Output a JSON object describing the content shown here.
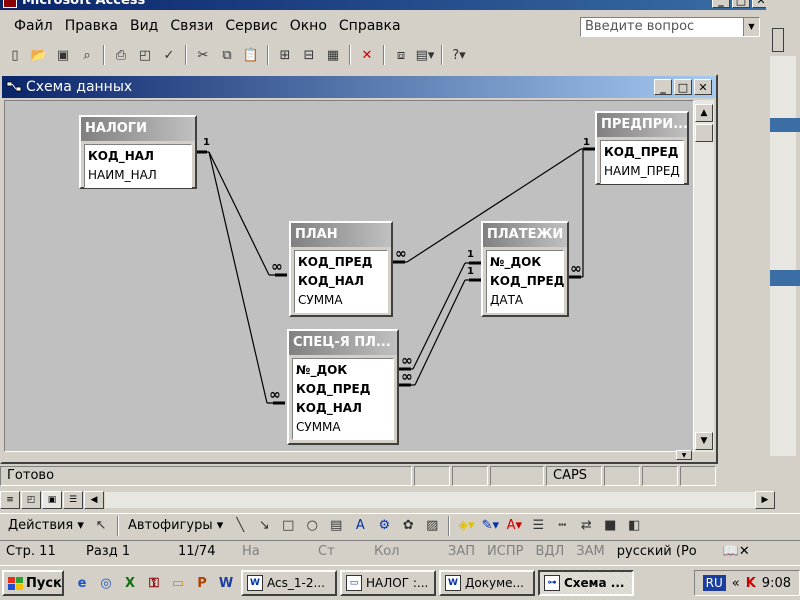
{
  "app": {
    "title": "Microsoft Access"
  },
  "menu": {
    "items": [
      "Файл",
      "Правка",
      "Вид",
      "Связи",
      "Сервис",
      "Окно",
      "Справка"
    ],
    "help_placeholder": "Введите вопрос"
  },
  "schema_window": {
    "title": "Схема данных",
    "tables": [
      {
        "name": "НАЛОГИ",
        "fields": [
          {
            "name": "КОД_НАЛ",
            "key": true
          },
          {
            "name": "НАИМ_НАЛ",
            "key": false
          }
        ]
      },
      {
        "name": "ПРЕДПРИ...",
        "fields": [
          {
            "name": "КОД_ПРЕД",
            "key": true
          },
          {
            "name": "НАИМ_ПРЕД",
            "key": false
          }
        ]
      },
      {
        "name": "ПЛАН",
        "fields": [
          {
            "name": "КОД_ПРЕД",
            "key": true
          },
          {
            "name": "КОД_НАЛ",
            "key": true
          },
          {
            "name": "СУММА",
            "key": false
          }
        ]
      },
      {
        "name": "ПЛАТЕЖИ",
        "fields": [
          {
            "name": "№_ДОК",
            "key": true
          },
          {
            "name": "КОД_ПРЕД",
            "key": true
          },
          {
            "name": "ДАТА",
            "key": false
          }
        ]
      },
      {
        "name": "СПЕЦ-Я ПЛ...",
        "fields": [
          {
            "name": "№_ДОК",
            "key": true
          },
          {
            "name": "КОД_ПРЕД",
            "key": true
          },
          {
            "name": "КОД_НАЛ",
            "key": true
          },
          {
            "name": "СУММА",
            "key": false
          }
        ]
      }
    ],
    "rel_one": "1",
    "rel_many": "∞"
  },
  "status": {
    "ready": "Готово",
    "caps": "CAPS"
  },
  "drawing_toolbar": {
    "actions": "Действия",
    "autoshapes": "Автофигуры"
  },
  "word_status": {
    "page": "Стр. 11",
    "section": "Разд 1",
    "pages": "11/74",
    "at": "На",
    "line": "Ст",
    "col": "Кол",
    "rec": "ЗАП",
    "trk": "ИСПР",
    "ext": "ВДЛ",
    "ovr": "ЗАМ",
    "lang": "русский (Ро"
  },
  "taskbar": {
    "start": "Пуск",
    "tasks": [
      "Acs_1-2...",
      "НАЛОГ :...",
      "Докуме...",
      "Схема ..."
    ],
    "lang": "RU",
    "clock": "9:08"
  }
}
